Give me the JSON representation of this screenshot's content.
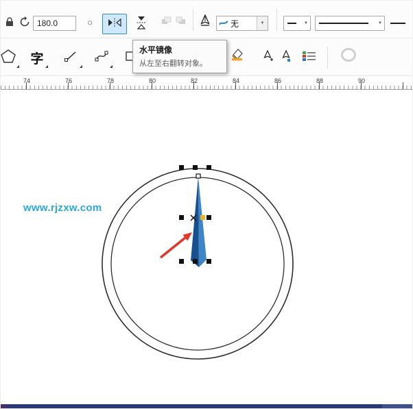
{
  "property_bar": {
    "rotation_angle": "180.0",
    "outline_width_value": "无"
  },
  "toolbox": {
    "text_tool_label": "字"
  },
  "tooltip": {
    "title": "水平镜像",
    "description": "从左至右翻转对象。"
  },
  "ruler": {
    "numbers": [
      "74",
      "76",
      "78",
      "80",
      "82",
      "84",
      "86",
      "88",
      "90"
    ]
  },
  "canvas": {
    "watermark": "www.rjzxw.com"
  },
  "icons": {
    "dropdown_arrow": "▼",
    "ellipse_glyph": "○"
  },
  "colors": {
    "accent": "#2f8bd6",
    "active_bg": "#cfe8fb",
    "needle_dark": "#17508f",
    "needle_light": "#3e85c6",
    "arrow_red": "#df372a",
    "watermark_blue": "#2aa7df",
    "node_yellow": "#f0b429",
    "taskbar_main": "#2a3a74",
    "taskbar_left": "#442e6c",
    "taskbar_right": "#3d5186"
  }
}
